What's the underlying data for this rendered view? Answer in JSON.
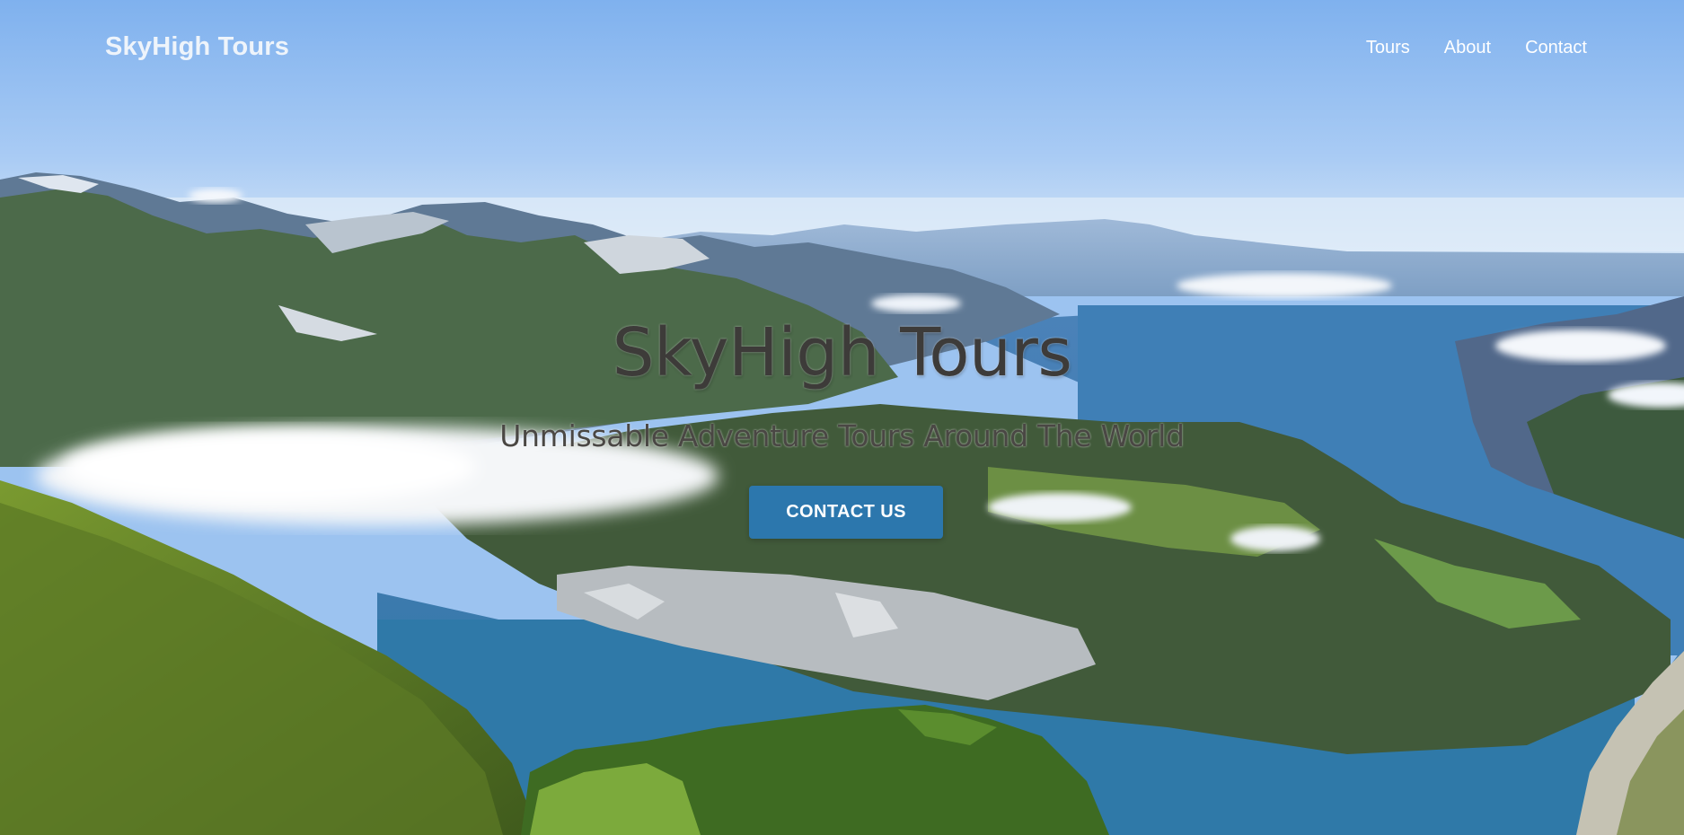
{
  "nav": {
    "brand": "SkyHigh Tours",
    "links": [
      "Tours",
      "About",
      "Contact"
    ]
  },
  "hero": {
    "title": "SkyHigh Tours",
    "subtitle": "Unmissable Adventure Tours Around The World",
    "cta_label": "CONTACT US",
    "background_image": "alpine-lake-mountain-landscape"
  },
  "colors": {
    "cta_background": "#2c77ad",
    "title_text": "#3d3b39",
    "nav_text": "#ffffff"
  }
}
